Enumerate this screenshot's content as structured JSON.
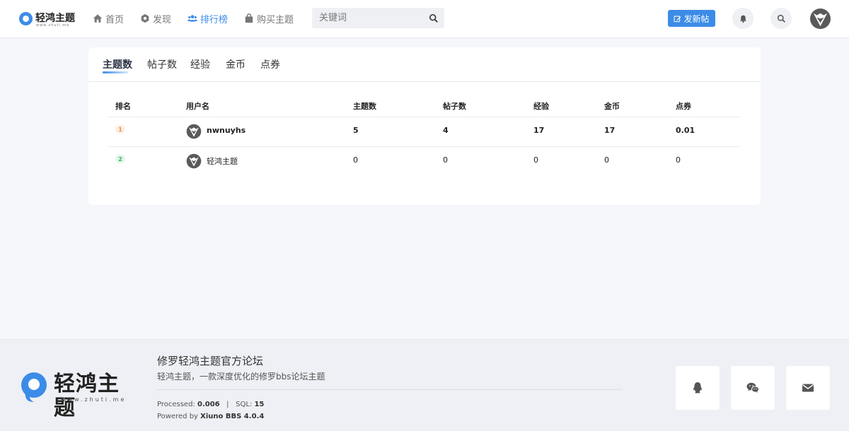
{
  "header": {
    "logo_text": "轻鸿主题",
    "logo_sub": "www.zhuti.me",
    "nav": [
      {
        "label": "首页",
        "icon": "home-icon"
      },
      {
        "label": "发现",
        "icon": "compass-icon"
      },
      {
        "label": "排行榜",
        "icon": "users-icon",
        "active": true
      },
      {
        "label": "购买主题",
        "icon": "bag-icon"
      }
    ],
    "search_placeholder": "关键词",
    "post_button": "发新帖",
    "accent": "#3c8ce7"
  },
  "tabs": [
    "主题数",
    "帖子数",
    "经验",
    "金币",
    "点券"
  ],
  "table": {
    "headers": [
      "排名",
      "用户名",
      "主题数",
      "帖子数",
      "经验",
      "金币",
      "点券"
    ],
    "rows": [
      {
        "rank": "1",
        "user": "nwnuyhs",
        "threads": "5",
        "posts": "4",
        "exp": "17",
        "gold": "17",
        "coupons": "0.01"
      },
      {
        "rank": "2",
        "user": "轻鸿主题",
        "threads": "0",
        "posts": "0",
        "exp": "0",
        "gold": "0",
        "coupons": "0"
      }
    ]
  },
  "footer": {
    "logo_text": "轻鸿主题",
    "logo_sub": "www.zhuti.me",
    "title": "修罗轻鸿主题官方论坛",
    "desc": "轻鸿主题，一款深度优化的修罗bbs论坛主题",
    "processed_label": "Processed:",
    "processed_value": "0.006",
    "sql_label": "SQL:",
    "sql_value": "15",
    "powered_label": "Powered by",
    "powered_value": "Xiuno BBS 4.0.4",
    "social": [
      "qq-icon",
      "wechat-icon",
      "mail-icon"
    ]
  }
}
